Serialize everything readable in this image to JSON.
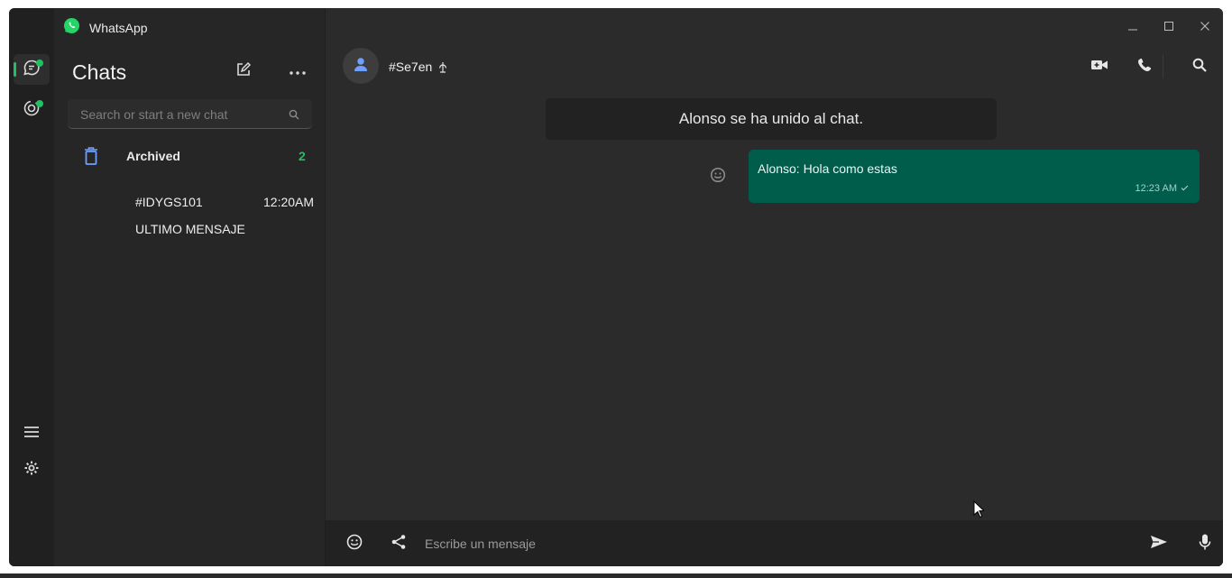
{
  "app": {
    "title": "WhatsApp",
    "accent_color": "#21c063",
    "bubble_color": "#005c4b"
  },
  "window_controls": {
    "minimize_icon": "minimize-icon",
    "maximize_icon": "maximize-icon",
    "close_icon": "close-icon"
  },
  "rail": {
    "items": [
      {
        "icon": "chats-icon",
        "active": true,
        "badge": true
      },
      {
        "icon": "status-icon",
        "active": false,
        "badge": true
      }
    ],
    "bottom_items": [
      {
        "icon": "menu-icon"
      },
      {
        "icon": "gear-icon"
      }
    ]
  },
  "sidebar": {
    "title": "Chats",
    "new_chat_icon": "compose-icon",
    "more_icon": "more-icon",
    "search": {
      "placeholder": "Search or start a new chat",
      "icon": "search-icon"
    },
    "archived": {
      "label": "Archived",
      "count": "2",
      "icon": "archive-icon"
    },
    "chats": [
      {
        "name": "#IDYGS101",
        "time": "12:20AM",
        "last_message": "ULTIMO MENSAJE"
      }
    ]
  },
  "conversation": {
    "contact_name": "#Se7en",
    "contact_suffix_icon": "pin-icon",
    "header_icons": [
      "video-call-icon",
      "phone-icon",
      "search-icon"
    ],
    "system_message": "Alonso se ha unido al chat.",
    "messages": [
      {
        "text": "Alonso: Hola como estas",
        "time": "12:23 AM",
        "status": "sent",
        "outgoing": true
      }
    ],
    "composer": {
      "placeholder": "Escribe un mensaje",
      "value": "",
      "icons": [
        "emoji-icon",
        "share-icon",
        "send-icon",
        "mic-icon"
      ]
    }
  }
}
